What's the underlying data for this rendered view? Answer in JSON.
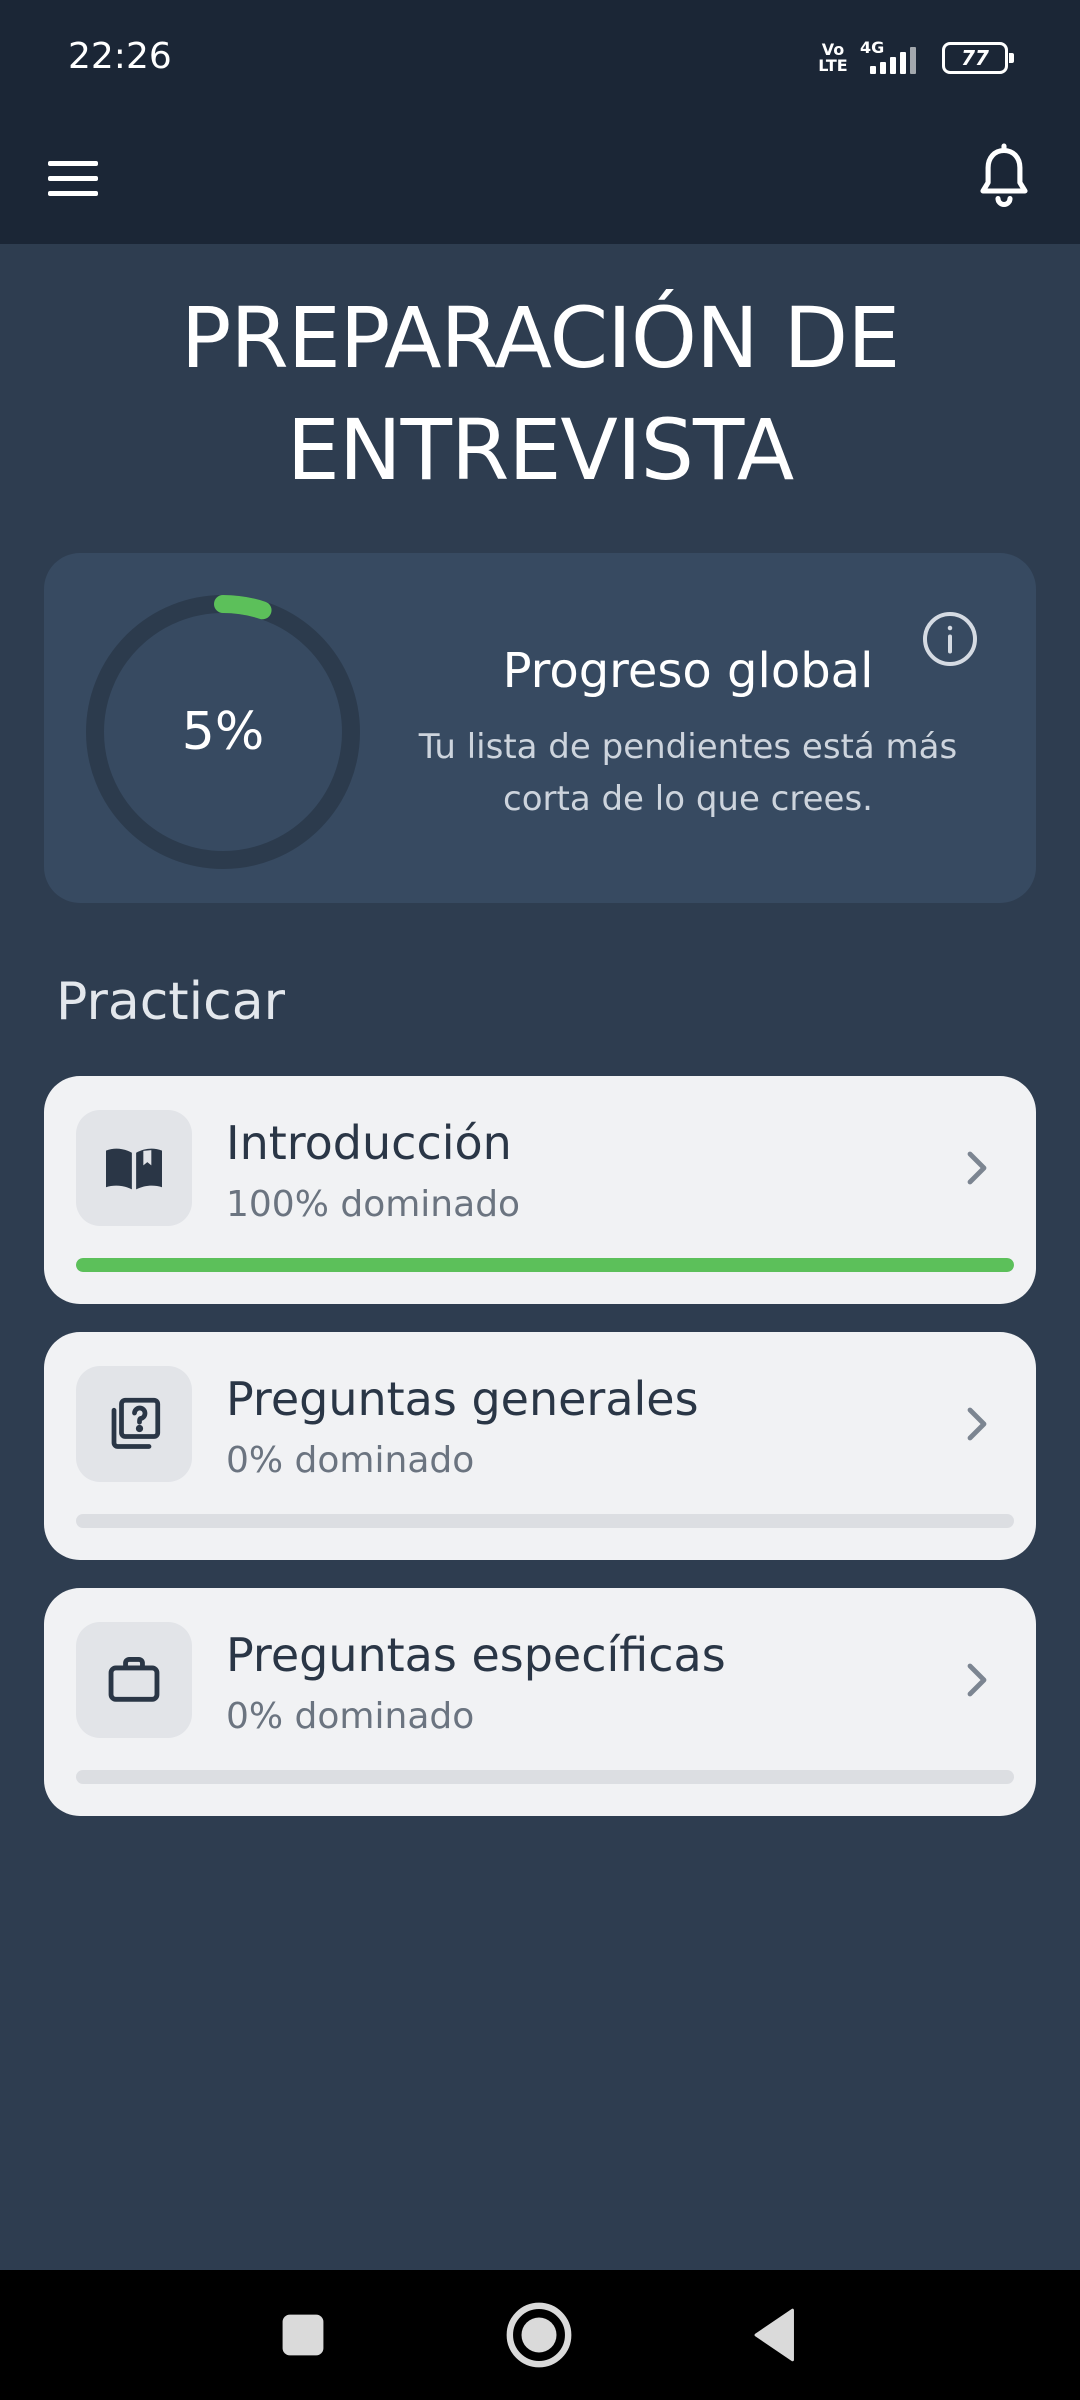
{
  "status_bar": {
    "time": "22:26",
    "volte": "Vo LTE",
    "network": "4G",
    "battery": "77",
    "icons": [
      "volte-icon",
      "signal-icon",
      "battery-icon"
    ]
  },
  "app_bar": {
    "left_icon": "menu-icon",
    "right_icon": "bell-icon"
  },
  "page": {
    "title": "PREPARACIÓN DE ENTREVISTA"
  },
  "progress": {
    "value_label": "5%",
    "value": 0.05,
    "title": "Progreso global",
    "description": "Tu lista de pendientes está más corta de lo que crees.",
    "icon": "info-icon"
  },
  "practice": {
    "title": "Practicar",
    "items": [
      {
        "name": "Introducción",
        "meta": "100% dominado",
        "progress": 1.0,
        "icon": "book-icon"
      },
      {
        "name": "Preguntas generales",
        "meta": "0% dominado",
        "progress": 0.0,
        "icon": "question-stack-icon"
      },
      {
        "name": "Preguntas específicas",
        "meta": "0% dominado",
        "progress": 0.0,
        "icon": "briefcase-icon"
      }
    ]
  },
  "nav_bar": {
    "icons": [
      "recents-icon",
      "home-icon",
      "back-icon"
    ]
  },
  "colors": {
    "background": "#2e3d50",
    "header": "#1b2636",
    "card": "#374a61",
    "accent_green": "#5cc05a",
    "lesson_card": "#f1f2f4"
  }
}
